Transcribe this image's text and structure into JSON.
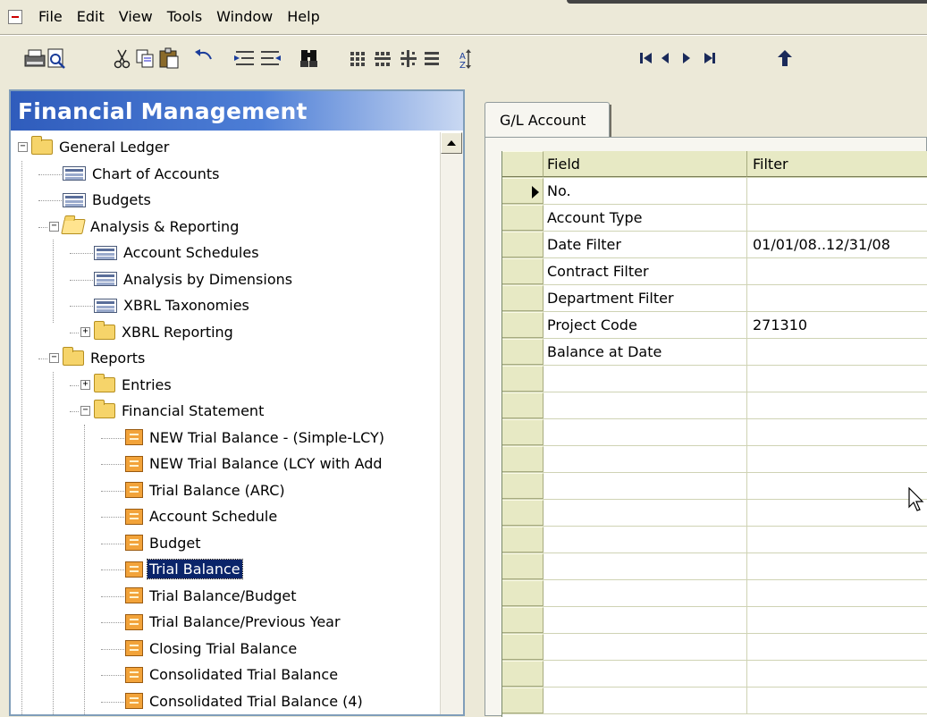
{
  "menubar": {
    "items": [
      "File",
      "Edit",
      "View",
      "Tools",
      "Window",
      "Help"
    ]
  },
  "toolbar": {
    "icons": [
      "print-icon",
      "print-preview-icon",
      "cut-icon",
      "copy-icon",
      "paste-icon",
      "undo-icon",
      "indent-icon",
      "outdent-icon",
      "find-icon",
      "sort-icon",
      "filter-icon",
      "field-filter-icon",
      "flowfilter-icon",
      "sort-ascending-icon",
      "first-record-icon",
      "previous-record-icon",
      "next-record-icon",
      "last-record-icon",
      "up-icon"
    ]
  },
  "nav": {
    "title": "Financial Management",
    "tree": [
      {
        "label": "General Ledger",
        "level": 0,
        "icon": "folder",
        "expander": "minus"
      },
      {
        "label": "Chart of Accounts",
        "level": 1,
        "icon": "form"
      },
      {
        "label": "Budgets",
        "level": 1,
        "icon": "form"
      },
      {
        "label": "Analysis & Reporting",
        "level": 1,
        "icon": "folder-open",
        "expander": "minus"
      },
      {
        "label": "Account Schedules",
        "level": 2,
        "icon": "form"
      },
      {
        "label": "Analysis by Dimensions",
        "level": 2,
        "icon": "form"
      },
      {
        "label": "XBRL Taxonomies",
        "level": 2,
        "icon": "form"
      },
      {
        "label": "XBRL Reporting",
        "level": 2,
        "icon": "folder",
        "expander": "plus"
      },
      {
        "label": "Reports",
        "level": 1,
        "icon": "folder",
        "expander": "minus"
      },
      {
        "label": "Entries",
        "level": 2,
        "icon": "folder",
        "expander": "plus"
      },
      {
        "label": "Financial Statement",
        "level": 2,
        "icon": "folder",
        "expander": "minus"
      },
      {
        "label": "NEW Trial Balance - (Simple-LCY)",
        "level": 3,
        "icon": "report"
      },
      {
        "label": "NEW Trial Balance (LCY with Add",
        "level": 3,
        "icon": "report"
      },
      {
        "label": "Trial Balance (ARC)",
        "level": 3,
        "icon": "report"
      },
      {
        "label": "Account Schedule",
        "level": 3,
        "icon": "report"
      },
      {
        "label": "Budget",
        "level": 3,
        "icon": "report"
      },
      {
        "label": "Trial Balance",
        "level": 3,
        "icon": "report",
        "selected": true
      },
      {
        "label": "Trial Balance/Budget",
        "level": 3,
        "icon": "report"
      },
      {
        "label": "Trial Balance/Previous Year",
        "level": 3,
        "icon": "report"
      },
      {
        "label": "Closing Trial Balance",
        "level": 3,
        "icon": "report"
      },
      {
        "label": "Consolidated Trial Balance",
        "level": 3,
        "icon": "report"
      },
      {
        "label": "Consolidated Trial Balance (4)",
        "level": 3,
        "icon": "report"
      }
    ]
  },
  "request": {
    "tab_label": "G/L Account",
    "columns": [
      "Field",
      "Filter"
    ],
    "rows": [
      {
        "field": "No.",
        "filter": "",
        "current": true
      },
      {
        "field": "Account Type",
        "filter": ""
      },
      {
        "field": "Date Filter",
        "filter": "01/01/08..12/31/08"
      },
      {
        "field": "Contract Filter",
        "filter": ""
      },
      {
        "field": "Department Filter",
        "filter": ""
      },
      {
        "field": "Project Code",
        "filter": "271310"
      },
      {
        "field": "Balance at Date",
        "filter": ""
      }
    ],
    "empty_rows": 13
  },
  "colors": {
    "nav_header": "#2f5cbc",
    "selection": "#0a246a",
    "grid_header": "#e7e9c4",
    "window_bg": "#ece9d8"
  }
}
